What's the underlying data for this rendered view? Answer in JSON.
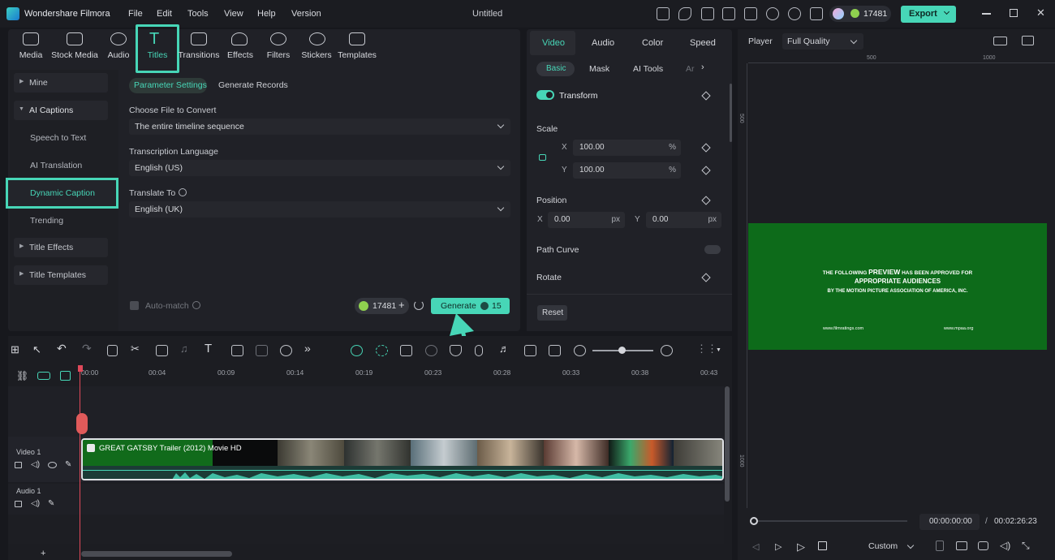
{
  "app": {
    "name": "Wondershare Filmora",
    "document": "Untitled",
    "menu": [
      "File",
      "Edit",
      "Tools",
      "View",
      "Help",
      "Version"
    ],
    "credits": "17481",
    "export_label": "Export"
  },
  "colors": {
    "accent": "#47d6b7",
    "highlight": "#47d6b7",
    "video_green": "#0d6b1a"
  },
  "top_tabs": [
    {
      "label": "Media",
      "icon": "media-icon"
    },
    {
      "label": "Stock Media",
      "icon": "stock-media-icon"
    },
    {
      "label": "Audio",
      "icon": "audio-icon"
    },
    {
      "label": "Titles",
      "icon": "titles-icon"
    },
    {
      "label": "Transitions",
      "icon": "transitions-icon"
    },
    {
      "label": "Effects",
      "icon": "effects-icon"
    },
    {
      "label": "Filters",
      "icon": "filters-icon"
    },
    {
      "label": "Stickers",
      "icon": "stickers-icon"
    },
    {
      "label": "Templates",
      "icon": "templates-icon"
    }
  ],
  "left_nav": {
    "mine": "Mine",
    "ai_captions": "AI Captions",
    "speech_to_text": "Speech to Text",
    "ai_translation": "AI Translation",
    "dynamic_caption": "Dynamic Caption",
    "trending": "Trending",
    "title_effects": "Title Effects",
    "title_templates": "Title Templates"
  },
  "caption_panel": {
    "tab_params": "Parameter Settings",
    "tab_records": "Generate Records",
    "file_label": "Choose File to Convert",
    "file_value": "The entire timeline sequence",
    "lang_label": "Transcription Language",
    "lang_value": "English (US)",
    "translate_label": "Translate To",
    "translate_value": "English (UK)",
    "auto_match": "Auto-match",
    "credits": "17481",
    "generate_label": "Generate",
    "generate_cost": "15"
  },
  "inspector": {
    "tabs": [
      "Video",
      "Audio",
      "Color",
      "Speed"
    ],
    "subtabs": [
      "Basic",
      "Mask",
      "AI Tools",
      "Ar"
    ],
    "transform": "Transform",
    "scale": "Scale",
    "scale_x": "100.00",
    "scale_y": "100.00",
    "percent": "%",
    "position": "Position",
    "pos_x": "0.00",
    "pos_y": "0.00",
    "px": "px",
    "path_curve": "Path Curve",
    "rotate": "Rotate",
    "reset": "Reset",
    "x": "X",
    "y": "Y"
  },
  "player": {
    "label": "Player",
    "quality": "Full Quality",
    "ruler": [
      "500",
      "1000",
      "500",
      "1000"
    ],
    "preview_line1a": "THE FOLLOWING",
    "preview_line1b": "PREVIEW",
    "preview_line1c": "HAS BEEN APPROVED FOR",
    "preview_line2": "APPROPRIATE AUDIENCES",
    "preview_line3": "BY THE MOTION PICTURE ASSOCIATION OF AMERICA, INC.",
    "preview_url1": "www.filmratings.com",
    "preview_url2": "www.mpaa.org",
    "time_current": "00:00:00:00",
    "time_sep": "/",
    "time_total": "00:02:26:23",
    "zoom": "Custom"
  },
  "timeline": {
    "ticks": [
      "00:00",
      "00:04",
      "00:09",
      "00:14",
      "00:19",
      "00:23",
      "00:28",
      "00:33",
      "00:38",
      "00:43"
    ],
    "video_track": "Video 1",
    "audio_track": "Audio 1",
    "clip_title": "GREAT GATSBY Trailer (2012) Movie HD",
    "add": "+"
  }
}
